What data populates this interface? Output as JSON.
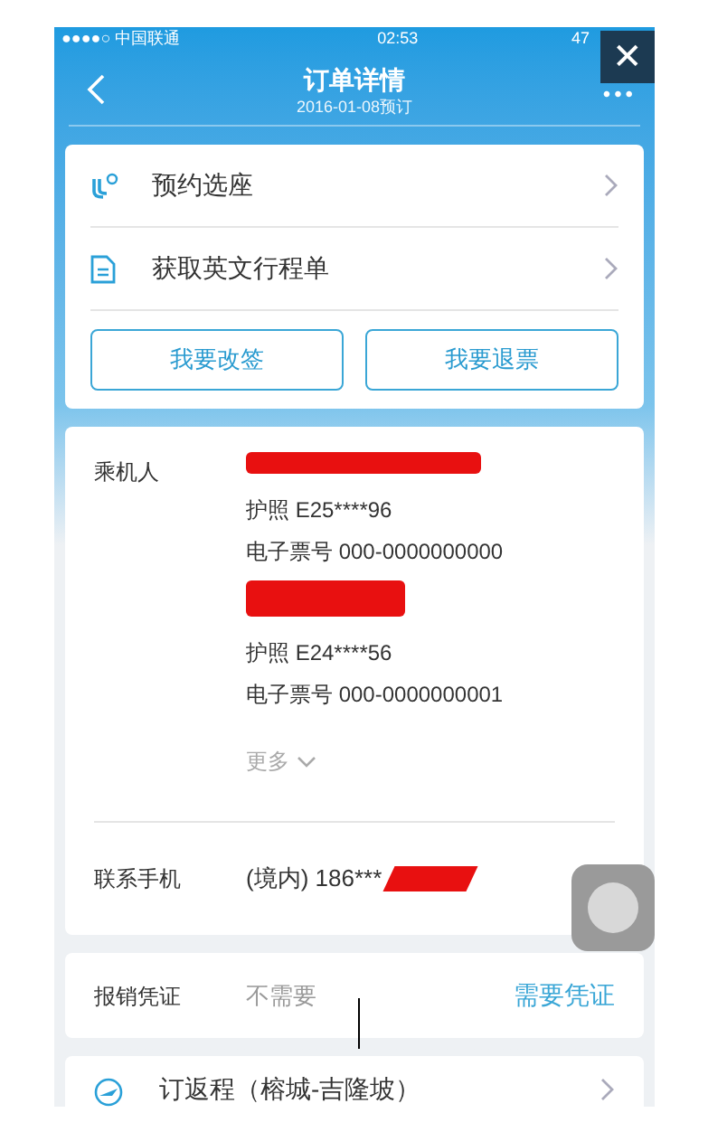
{
  "status_bar": {
    "carrier": "●●●●○ 中国联通",
    "time": "02:53",
    "battery": "47"
  },
  "nav": {
    "title": "订单详情",
    "subtitle": "2016-01-08预订",
    "more": "•••",
    "close": "✕"
  },
  "actions": [
    {
      "kind": "seat",
      "label": "预约选座"
    },
    {
      "kind": "doc",
      "label": "获取英文行程单"
    }
  ],
  "buttons": [
    "我要改签",
    "我要退票"
  ],
  "passengers": {
    "label": "乘机人",
    "items": [
      {
        "passport": "护照 E25****96",
        "ticket": "电子票号 000-0000000000"
      },
      {
        "passport": "护照 E24****56",
        "ticket": "电子票号 000-0000000001"
      }
    ],
    "more": "更多"
  },
  "contact": {
    "label": "联系手机",
    "value": "(境内) 186***"
  },
  "invoice": {
    "label": "报销凭证",
    "value": "不需要",
    "action": "需要凭证"
  },
  "return_trip": {
    "label": "订返程（榕城-吉隆坡）"
  }
}
